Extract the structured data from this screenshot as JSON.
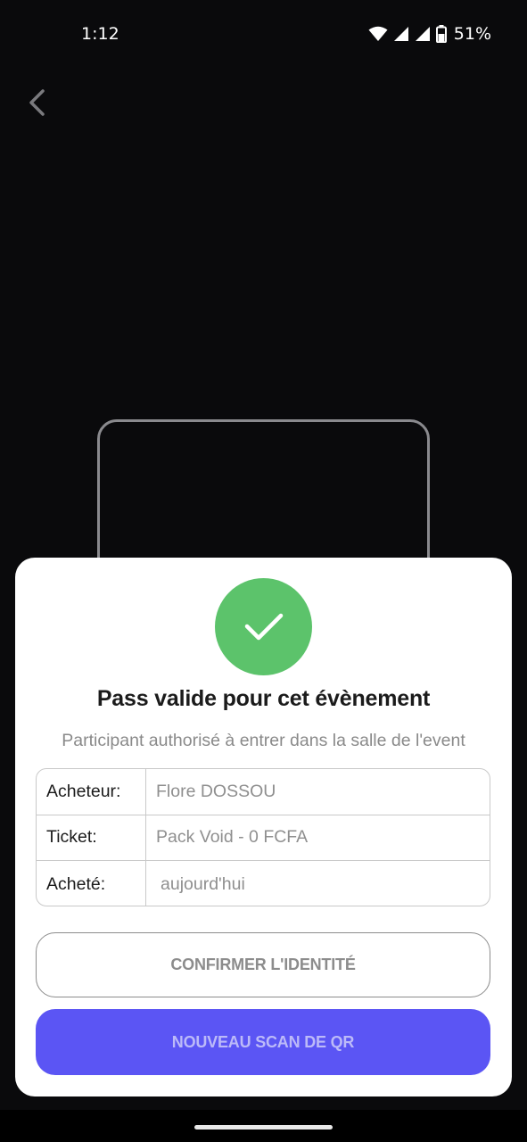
{
  "status_bar": {
    "time": "1:12",
    "battery_percent": "51%",
    "icons": [
      "wifi-icon",
      "signal-icon",
      "signal-icon",
      "battery-icon"
    ]
  },
  "navigation": {
    "back_icon": "chevron-left-icon"
  },
  "result_sheet": {
    "status_icon": "checkmark-icon",
    "status_color": "#5cc36b",
    "title": "Pass valide pour cet évènement",
    "subtitle": "Participant authorisé à entrer dans la salle de l'event",
    "details": [
      {
        "label": "Acheteur:",
        "value": "Flore DOSSOU"
      },
      {
        "label": "Ticket:",
        "value": "Pack Void - 0 FCFA"
      },
      {
        "label": "Acheté:",
        "value": "aujourd'hui"
      }
    ],
    "confirm_button": "CONFIRMER L'IDENTITÉ",
    "new_scan_button": "NOUVEAU SCAN DE QR",
    "accent_color": "#5b55f4"
  }
}
